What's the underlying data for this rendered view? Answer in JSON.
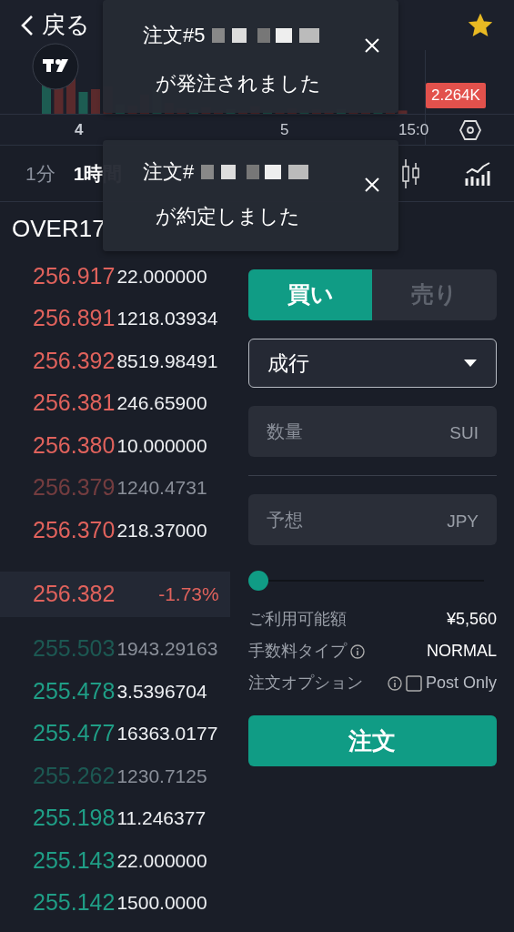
{
  "header": {
    "back_label": "戻る",
    "favorite": {
      "on": true
    }
  },
  "chart": {
    "price_tag": "2.264K",
    "time_labels": [
      "4",
      "5",
      "15:0"
    ]
  },
  "timeframes": [
    {
      "label": "1分",
      "selected": false
    },
    {
      "label": "1時間",
      "selected": true
    }
  ],
  "market_label": "OVER17",
  "asks": [
    {
      "price": "256.917",
      "amount": "22.000000",
      "faded": false
    },
    {
      "price": "256.891",
      "amount": "1218.03934",
      "faded": false
    },
    {
      "price": "256.392",
      "amount": "8519.98491",
      "faded": false
    },
    {
      "price": "256.381",
      "amount": "246.65900",
      "faded": false
    },
    {
      "price": "256.380",
      "amount": "10.000000",
      "faded": false
    },
    {
      "price": "256.379",
      "amount": "1240.4731",
      "faded": true
    },
    {
      "price": "256.370",
      "amount": "218.37000",
      "faded": false
    }
  ],
  "last": {
    "price": "256.382",
    "change": "-1.73%"
  },
  "bids": [
    {
      "price": "255.503",
      "amount": "1943.29163",
      "faded": true
    },
    {
      "price": "255.478",
      "amount": "3.5396704",
      "faded": false
    },
    {
      "price": "255.477",
      "amount": "16363.0177",
      "faded": false
    },
    {
      "price": "255.262",
      "amount": "1230.7125",
      "faded": true
    },
    {
      "price": "255.198",
      "amount": "11.246377",
      "faded": false
    },
    {
      "price": "255.143",
      "amount": "22.000000",
      "faded": false
    },
    {
      "price": "255.142",
      "amount": "1500.0000",
      "faded": false
    }
  ],
  "order_form": {
    "sides": [
      {
        "label": "買い",
        "selected": true
      },
      {
        "label": "売り",
        "selected": false
      }
    ],
    "order_type": "成行",
    "quantity": {
      "placeholder": "数量",
      "unit": "SUI"
    },
    "estimate": {
      "placeholder": "予想",
      "unit": "JPY"
    },
    "slider": {
      "level": 0
    },
    "info_rows": [
      {
        "kind": "plain",
        "label": "ご利用可能額",
        "value": "¥5,560"
      },
      {
        "kind": "info",
        "label": "手数料タイプ",
        "value": "NORMAL"
      },
      {
        "kind": "checkbox",
        "label": "注文オプション",
        "value": "Post Only",
        "checked": false
      }
    ],
    "submit_label": "注文"
  },
  "toasts": [
    {
      "title": "注文#5",
      "message": "が発注されました"
    },
    {
      "title": "注文#",
      "message": "が約定しました"
    }
  ]
}
